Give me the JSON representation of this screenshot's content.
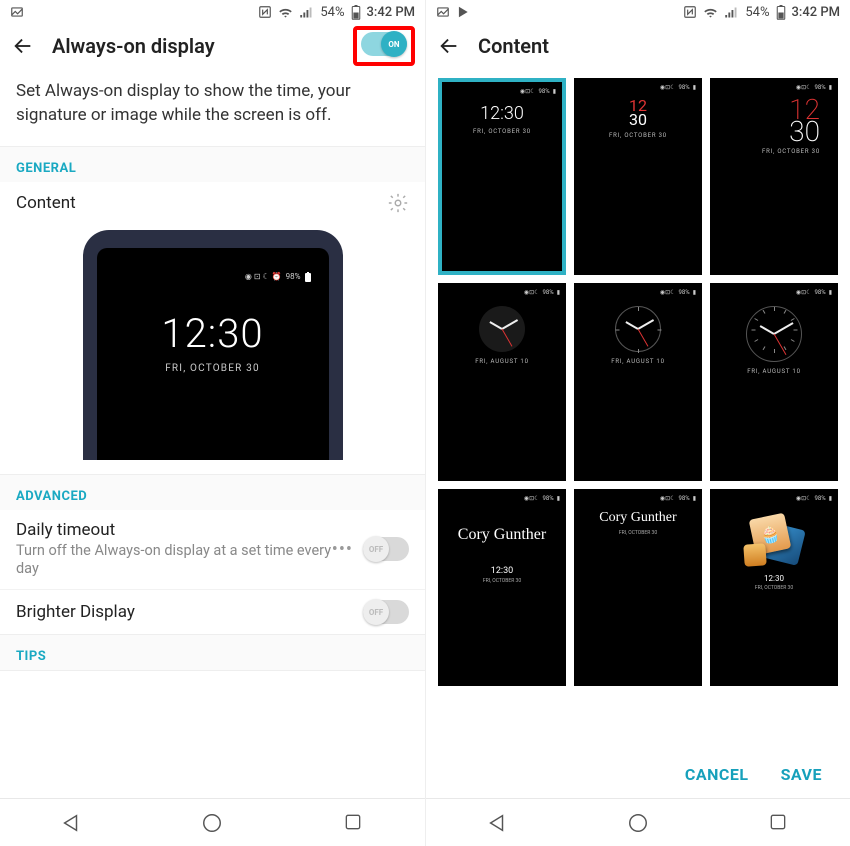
{
  "statusbar": {
    "battery": "54%",
    "time": "3:42 PM"
  },
  "left": {
    "title": "Always-on display",
    "toggle_label": "ON",
    "description": "Set Always-on display to show the time, your signature or image while the screen is off.",
    "sections": {
      "general": "GENERAL",
      "advanced": "ADVANCED",
      "tips": "TIPS"
    },
    "content_row": "Content",
    "preview": {
      "battery": "98%",
      "time": "12:30",
      "date": "FRI, OCTOBER 30"
    },
    "daily_timeout": {
      "title": "Daily timeout",
      "sub": "Turn off the Always-on display at a set time every day",
      "toggle_label": "OFF"
    },
    "brighter": {
      "title": "Brighter Display",
      "toggle_label": "OFF"
    }
  },
  "right": {
    "title": "Content",
    "thumbs": {
      "status_battery": "98%",
      "t1": {
        "time": "12:30",
        "date": "FRI, OCTOBER 30"
      },
      "t2": {
        "time_top": "12",
        "time_bot": "30",
        "date": "FRI, OCTOBER 30"
      },
      "t3": {
        "hr": "12",
        "mn": "30",
        "date": "FRI, OCTOBER 30"
      },
      "t4": {
        "date": "FRI, AUGUST 10"
      },
      "t5": {
        "date": "FRI, AUGUST 10"
      },
      "t6": {
        "date": "FRI, AUGUST 10"
      },
      "t7": {
        "name": "Cory Gunther",
        "time": "12:30",
        "date": "FRI, OCTOBER 30"
      },
      "t8": {
        "name": "Cory Gunther",
        "date": "FRI, OCTOBER 30"
      },
      "t9": {
        "time": "12:30",
        "date": "FRI, OCTOBER 30"
      }
    },
    "cancel": "CANCEL",
    "save": "SAVE"
  }
}
